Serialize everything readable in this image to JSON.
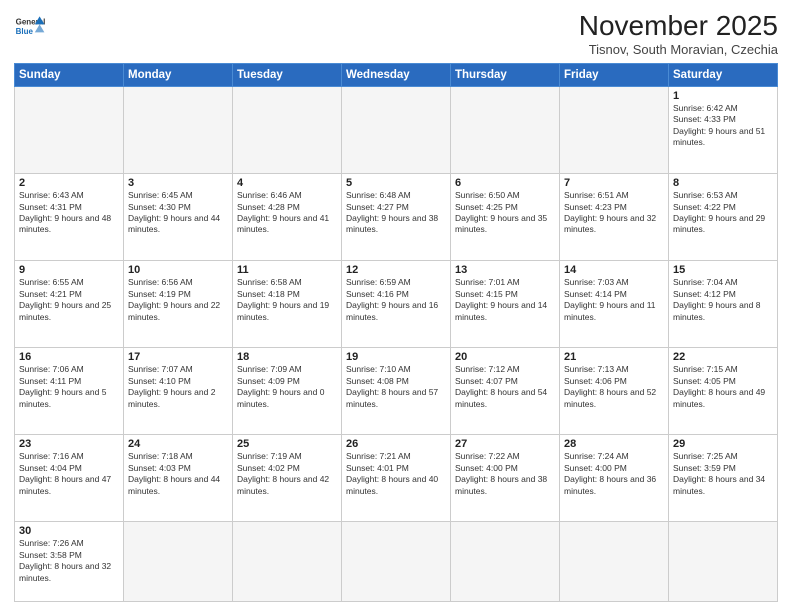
{
  "header": {
    "logo_general": "General",
    "logo_blue": "Blue",
    "month_year": "November 2025",
    "location": "Tisnov, South Moravian, Czechia"
  },
  "weekdays": [
    "Sunday",
    "Monday",
    "Tuesday",
    "Wednesday",
    "Thursday",
    "Friday",
    "Saturday"
  ],
  "weeks": [
    [
      {
        "day": null,
        "empty": true
      },
      {
        "day": null,
        "empty": true
      },
      {
        "day": null,
        "empty": true
      },
      {
        "day": null,
        "empty": true
      },
      {
        "day": null,
        "empty": true
      },
      {
        "day": null,
        "empty": true
      },
      {
        "day": 1,
        "sunrise": "6:42 AM",
        "sunset": "4:33 PM",
        "daylight": "9 hours and 51 minutes."
      }
    ],
    [
      {
        "day": 2,
        "sunrise": "6:43 AM",
        "sunset": "4:31 PM",
        "daylight": "9 hours and 48 minutes."
      },
      {
        "day": 3,
        "sunrise": "6:45 AM",
        "sunset": "4:30 PM",
        "daylight": "9 hours and 44 minutes."
      },
      {
        "day": 4,
        "sunrise": "6:46 AM",
        "sunset": "4:28 PM",
        "daylight": "9 hours and 41 minutes."
      },
      {
        "day": 5,
        "sunrise": "6:48 AM",
        "sunset": "4:27 PM",
        "daylight": "9 hours and 38 minutes."
      },
      {
        "day": 6,
        "sunrise": "6:50 AM",
        "sunset": "4:25 PM",
        "daylight": "9 hours and 35 minutes."
      },
      {
        "day": 7,
        "sunrise": "6:51 AM",
        "sunset": "4:23 PM",
        "daylight": "9 hours and 32 minutes."
      },
      {
        "day": 8,
        "sunrise": "6:53 AM",
        "sunset": "4:22 PM",
        "daylight": "9 hours and 29 minutes."
      }
    ],
    [
      {
        "day": 9,
        "sunrise": "6:55 AM",
        "sunset": "4:21 PM",
        "daylight": "9 hours and 25 minutes."
      },
      {
        "day": 10,
        "sunrise": "6:56 AM",
        "sunset": "4:19 PM",
        "daylight": "9 hours and 22 minutes."
      },
      {
        "day": 11,
        "sunrise": "6:58 AM",
        "sunset": "4:18 PM",
        "daylight": "9 hours and 19 minutes."
      },
      {
        "day": 12,
        "sunrise": "6:59 AM",
        "sunset": "4:16 PM",
        "daylight": "9 hours and 16 minutes."
      },
      {
        "day": 13,
        "sunrise": "7:01 AM",
        "sunset": "4:15 PM",
        "daylight": "9 hours and 14 minutes."
      },
      {
        "day": 14,
        "sunrise": "7:03 AM",
        "sunset": "4:14 PM",
        "daylight": "9 hours and 11 minutes."
      },
      {
        "day": 15,
        "sunrise": "7:04 AM",
        "sunset": "4:12 PM",
        "daylight": "9 hours and 8 minutes."
      }
    ],
    [
      {
        "day": 16,
        "sunrise": "7:06 AM",
        "sunset": "4:11 PM",
        "daylight": "9 hours and 5 minutes."
      },
      {
        "day": 17,
        "sunrise": "7:07 AM",
        "sunset": "4:10 PM",
        "daylight": "9 hours and 2 minutes."
      },
      {
        "day": 18,
        "sunrise": "7:09 AM",
        "sunset": "4:09 PM",
        "daylight": "9 hours and 0 minutes."
      },
      {
        "day": 19,
        "sunrise": "7:10 AM",
        "sunset": "4:08 PM",
        "daylight": "8 hours and 57 minutes."
      },
      {
        "day": 20,
        "sunrise": "7:12 AM",
        "sunset": "4:07 PM",
        "daylight": "8 hours and 54 minutes."
      },
      {
        "day": 21,
        "sunrise": "7:13 AM",
        "sunset": "4:06 PM",
        "daylight": "8 hours and 52 minutes."
      },
      {
        "day": 22,
        "sunrise": "7:15 AM",
        "sunset": "4:05 PM",
        "daylight": "8 hours and 49 minutes."
      }
    ],
    [
      {
        "day": 23,
        "sunrise": "7:16 AM",
        "sunset": "4:04 PM",
        "daylight": "8 hours and 47 minutes."
      },
      {
        "day": 24,
        "sunrise": "7:18 AM",
        "sunset": "4:03 PM",
        "daylight": "8 hours and 44 minutes."
      },
      {
        "day": 25,
        "sunrise": "7:19 AM",
        "sunset": "4:02 PM",
        "daylight": "8 hours and 42 minutes."
      },
      {
        "day": 26,
        "sunrise": "7:21 AM",
        "sunset": "4:01 PM",
        "daylight": "8 hours and 40 minutes."
      },
      {
        "day": 27,
        "sunrise": "7:22 AM",
        "sunset": "4:00 PM",
        "daylight": "8 hours and 38 minutes."
      },
      {
        "day": 28,
        "sunrise": "7:24 AM",
        "sunset": "4:00 PM",
        "daylight": "8 hours and 36 minutes."
      },
      {
        "day": 29,
        "sunrise": "7:25 AM",
        "sunset": "3:59 PM",
        "daylight": "8 hours and 34 minutes."
      }
    ],
    [
      {
        "day": 30,
        "sunrise": "7:26 AM",
        "sunset": "3:58 PM",
        "daylight": "8 hours and 32 minutes."
      },
      {
        "day": null,
        "empty": true
      },
      {
        "day": null,
        "empty": true
      },
      {
        "day": null,
        "empty": true
      },
      {
        "day": null,
        "empty": true
      },
      {
        "day": null,
        "empty": true
      },
      {
        "day": null,
        "empty": true
      }
    ]
  ]
}
